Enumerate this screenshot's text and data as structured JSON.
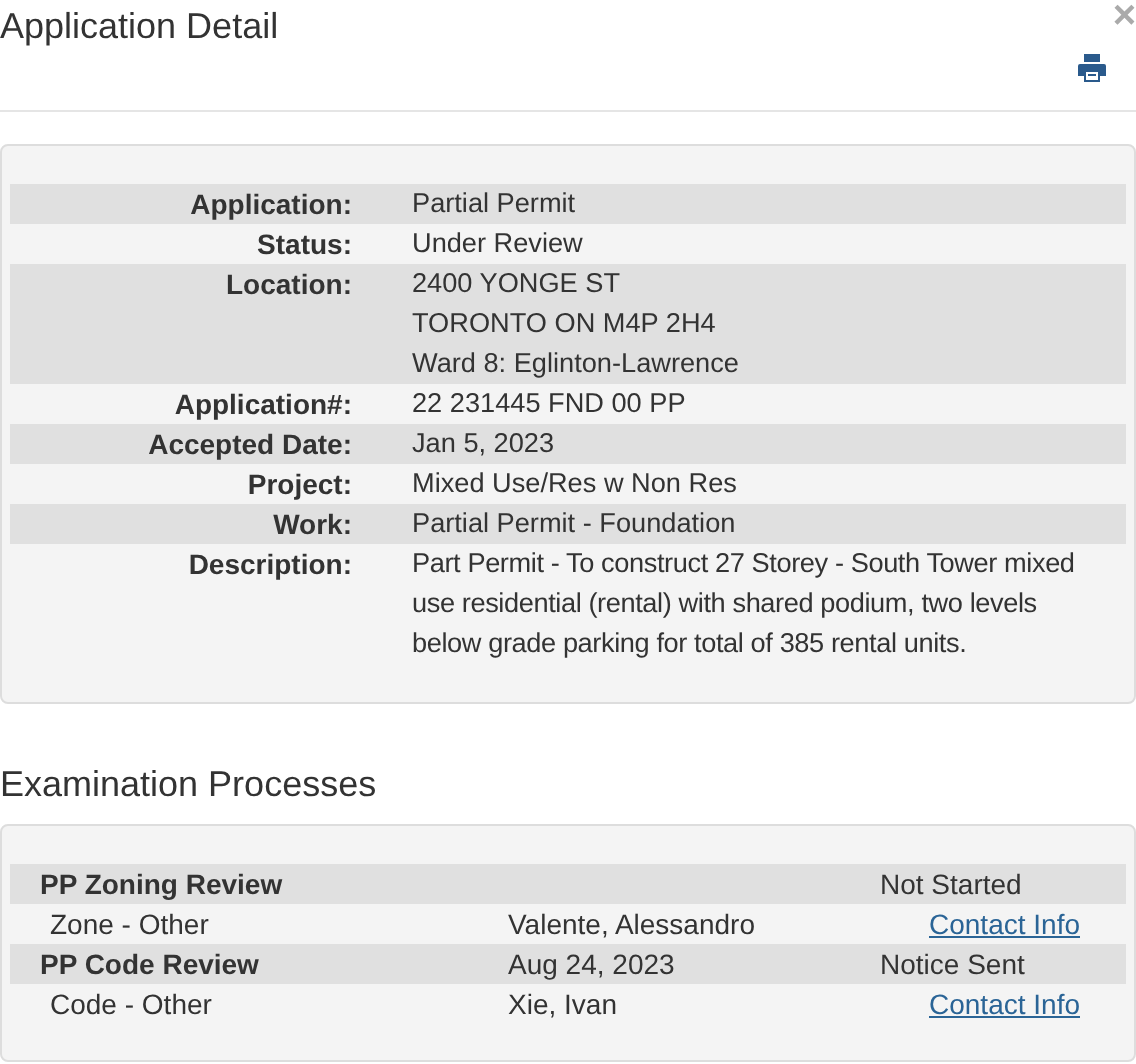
{
  "dialog": {
    "title": "Application Detail",
    "close": "×"
  },
  "details": [
    {
      "label": "Application:",
      "lines": [
        "Partial Permit"
      ]
    },
    {
      "label": "Status:",
      "lines": [
        "Under Review"
      ]
    },
    {
      "label": "Location:",
      "lines": [
        "2400 YONGE ST",
        "TORONTO ON M4P 2H4",
        "Ward 8: Eglinton-Lawrence"
      ]
    },
    {
      "label": "Application#:",
      "lines": [
        "22 231445 FND 00 PP"
      ]
    },
    {
      "label": "Accepted Date:",
      "lines": [
        "Jan 5, 2023"
      ]
    },
    {
      "label": "Project:",
      "lines": [
        "Mixed Use/Res w Non Res"
      ]
    },
    {
      "label": "Work:",
      "lines": [
        "Partial Permit - Foundation"
      ]
    },
    {
      "label": "Description:",
      "lines": [
        "Part Permit - To construct 27 Storey - South Tower mixed use residential (rental) with shared podium, two levels below grade parking for total of 385 rental units."
      ]
    }
  ],
  "examination": {
    "heading": "Examination Processes",
    "processes": [
      {
        "name": "PP Zoning Review",
        "status": "Not Started",
        "tasks": [
          {
            "name": "Zone - Other",
            "reviewer": "Valente, Alessandro",
            "link": "Contact Info"
          }
        ]
      },
      {
        "name": "PP Code Review",
        "date": "Aug 24, 2023",
        "status": "Notice Sent",
        "tasks": [
          {
            "name": "Code - Other",
            "reviewer": "Xie, Ivan",
            "link": "Contact Info"
          }
        ]
      }
    ]
  }
}
